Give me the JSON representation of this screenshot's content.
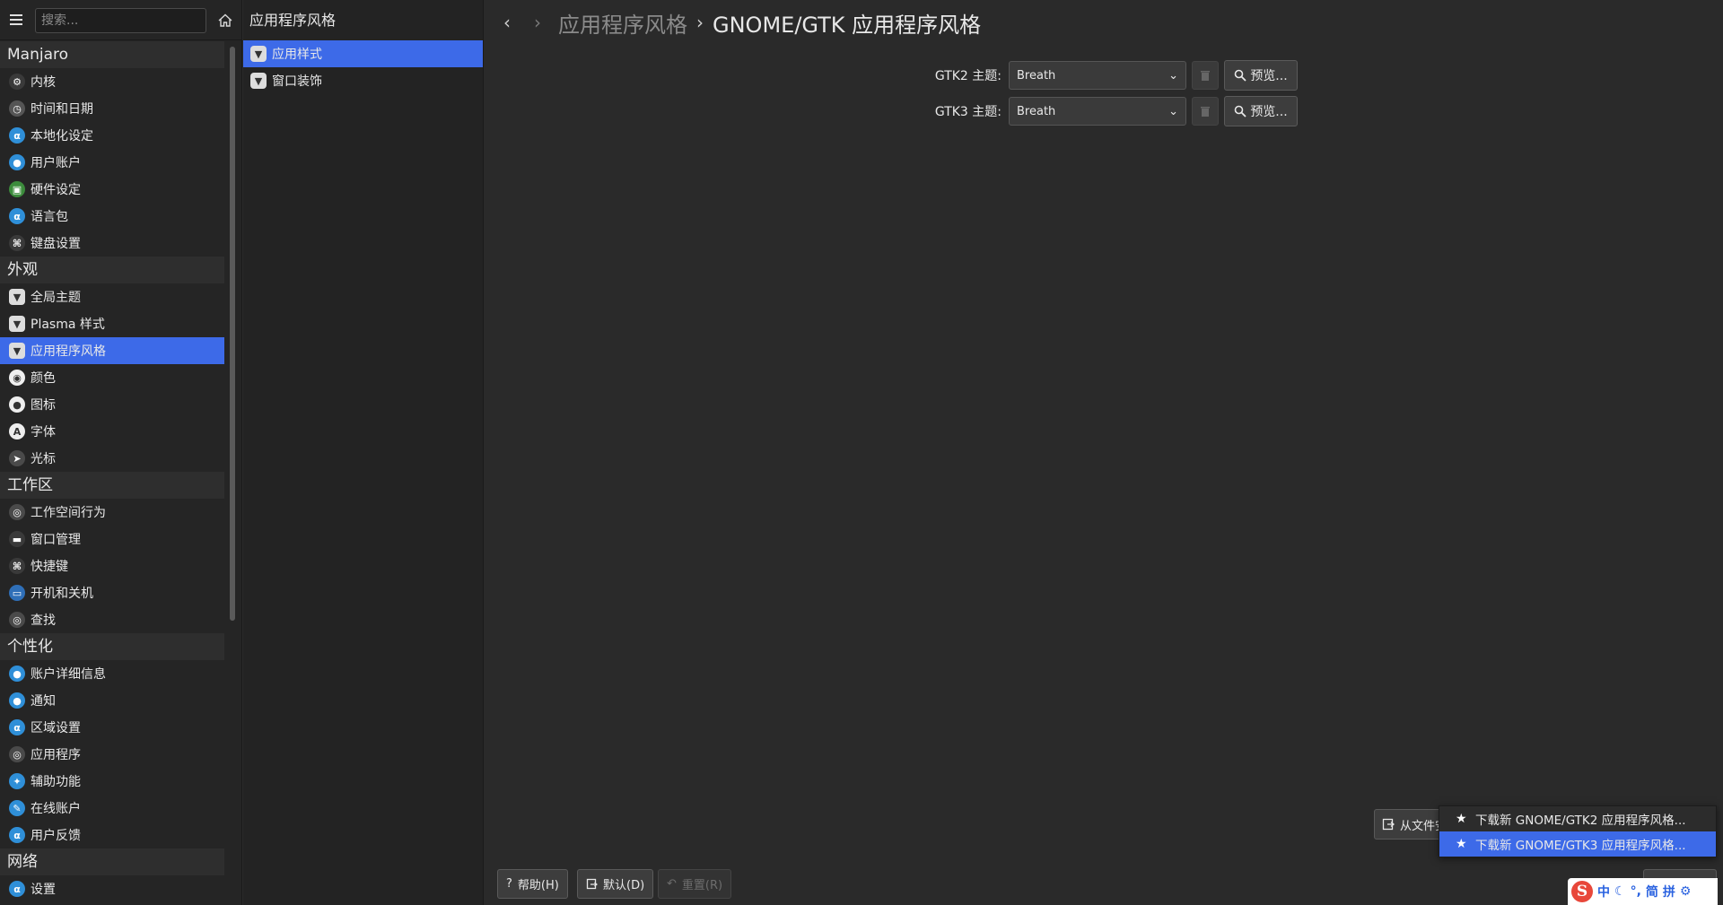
{
  "sidebar": {
    "search_placeholder": "搜索...",
    "sections": [
      {
        "header": "Manjaro",
        "items": [
          {
            "label": "内核",
            "icon": "gear-icon"
          },
          {
            "label": "时间和日期",
            "icon": "clock-icon"
          },
          {
            "label": "本地化设定",
            "icon": "locale-icon"
          },
          {
            "label": "用户账户",
            "icon": "user-icon"
          },
          {
            "label": "硬件设定",
            "icon": "hardware-icon"
          },
          {
            "label": "语言包",
            "icon": "language-icon"
          },
          {
            "label": "键盘设置",
            "icon": "keyboard-icon"
          }
        ]
      },
      {
        "header": "外观",
        "items": [
          {
            "label": "全局主题",
            "icon": "theme-icon"
          },
          {
            "label": "Plasma 样式",
            "icon": "theme-icon"
          },
          {
            "label": "应用程序风格",
            "icon": "theme-icon",
            "selected": true
          },
          {
            "label": "颜色",
            "icon": "color-icon"
          },
          {
            "label": "图标",
            "icon": "icons-icon"
          },
          {
            "label": "字体",
            "icon": "font-icon"
          },
          {
            "label": "光标",
            "icon": "cursor-icon"
          }
        ]
      },
      {
        "header": "工作区",
        "items": [
          {
            "label": "工作空间行为",
            "icon": "workspace-icon"
          },
          {
            "label": "窗口管理",
            "icon": "window-icon"
          },
          {
            "label": "快捷键",
            "icon": "shortcut-icon"
          },
          {
            "label": "开机和关机",
            "icon": "power-icon"
          },
          {
            "label": "查找",
            "icon": "search-icon"
          }
        ]
      },
      {
        "header": "个性化",
        "items": [
          {
            "label": "账户详细信息",
            "icon": "user-icon"
          },
          {
            "label": "通知",
            "icon": "notification-icon"
          },
          {
            "label": "区域设置",
            "icon": "locale-icon"
          },
          {
            "label": "应用程序",
            "icon": "applications-icon"
          },
          {
            "label": "辅助功能",
            "icon": "accessibility-icon"
          },
          {
            "label": "在线账户",
            "icon": "online-accounts-icon"
          },
          {
            "label": "用户反馈",
            "icon": "feedback-icon"
          }
        ]
      },
      {
        "header": "网络",
        "items": [
          {
            "label": "设置",
            "icon": "network-settings-icon"
          }
        ]
      }
    ]
  },
  "midpanel": {
    "title": "应用程序风格",
    "items": [
      {
        "label": "应用样式",
        "selected": true
      },
      {
        "label": "窗口装饰",
        "selected": false
      }
    ]
  },
  "main": {
    "breadcrumb_parent": "应用程序风格",
    "breadcrumb_current": "GNOME/GTK 应用程序风格",
    "gtk2_label": "GTK2 主题:",
    "gtk2_value": "Breath",
    "gtk3_label": "GTK3 主题:",
    "gtk3_value": "Breath",
    "preview_label": "预览..."
  },
  "footer": {
    "help_label": "帮助(H)",
    "defaults_label": "默认(D)",
    "reset_label": "重置(R)",
    "file_install_label": "从文件安"
  },
  "menu": {
    "items": [
      "下载新 GNOME/GTK2 应用程序风格...",
      "下载新 GNOME/GTK3 应用程序风格..."
    ]
  },
  "ime": {
    "mode": "中",
    "moon": "☾",
    "punct": "°,",
    "simp": "简",
    "pinyin": "拼",
    "settings": "⚙"
  },
  "colors": {
    "accent": "#3d6ae8",
    "background": "#2a2a2a",
    "sidebar": "#252525"
  }
}
